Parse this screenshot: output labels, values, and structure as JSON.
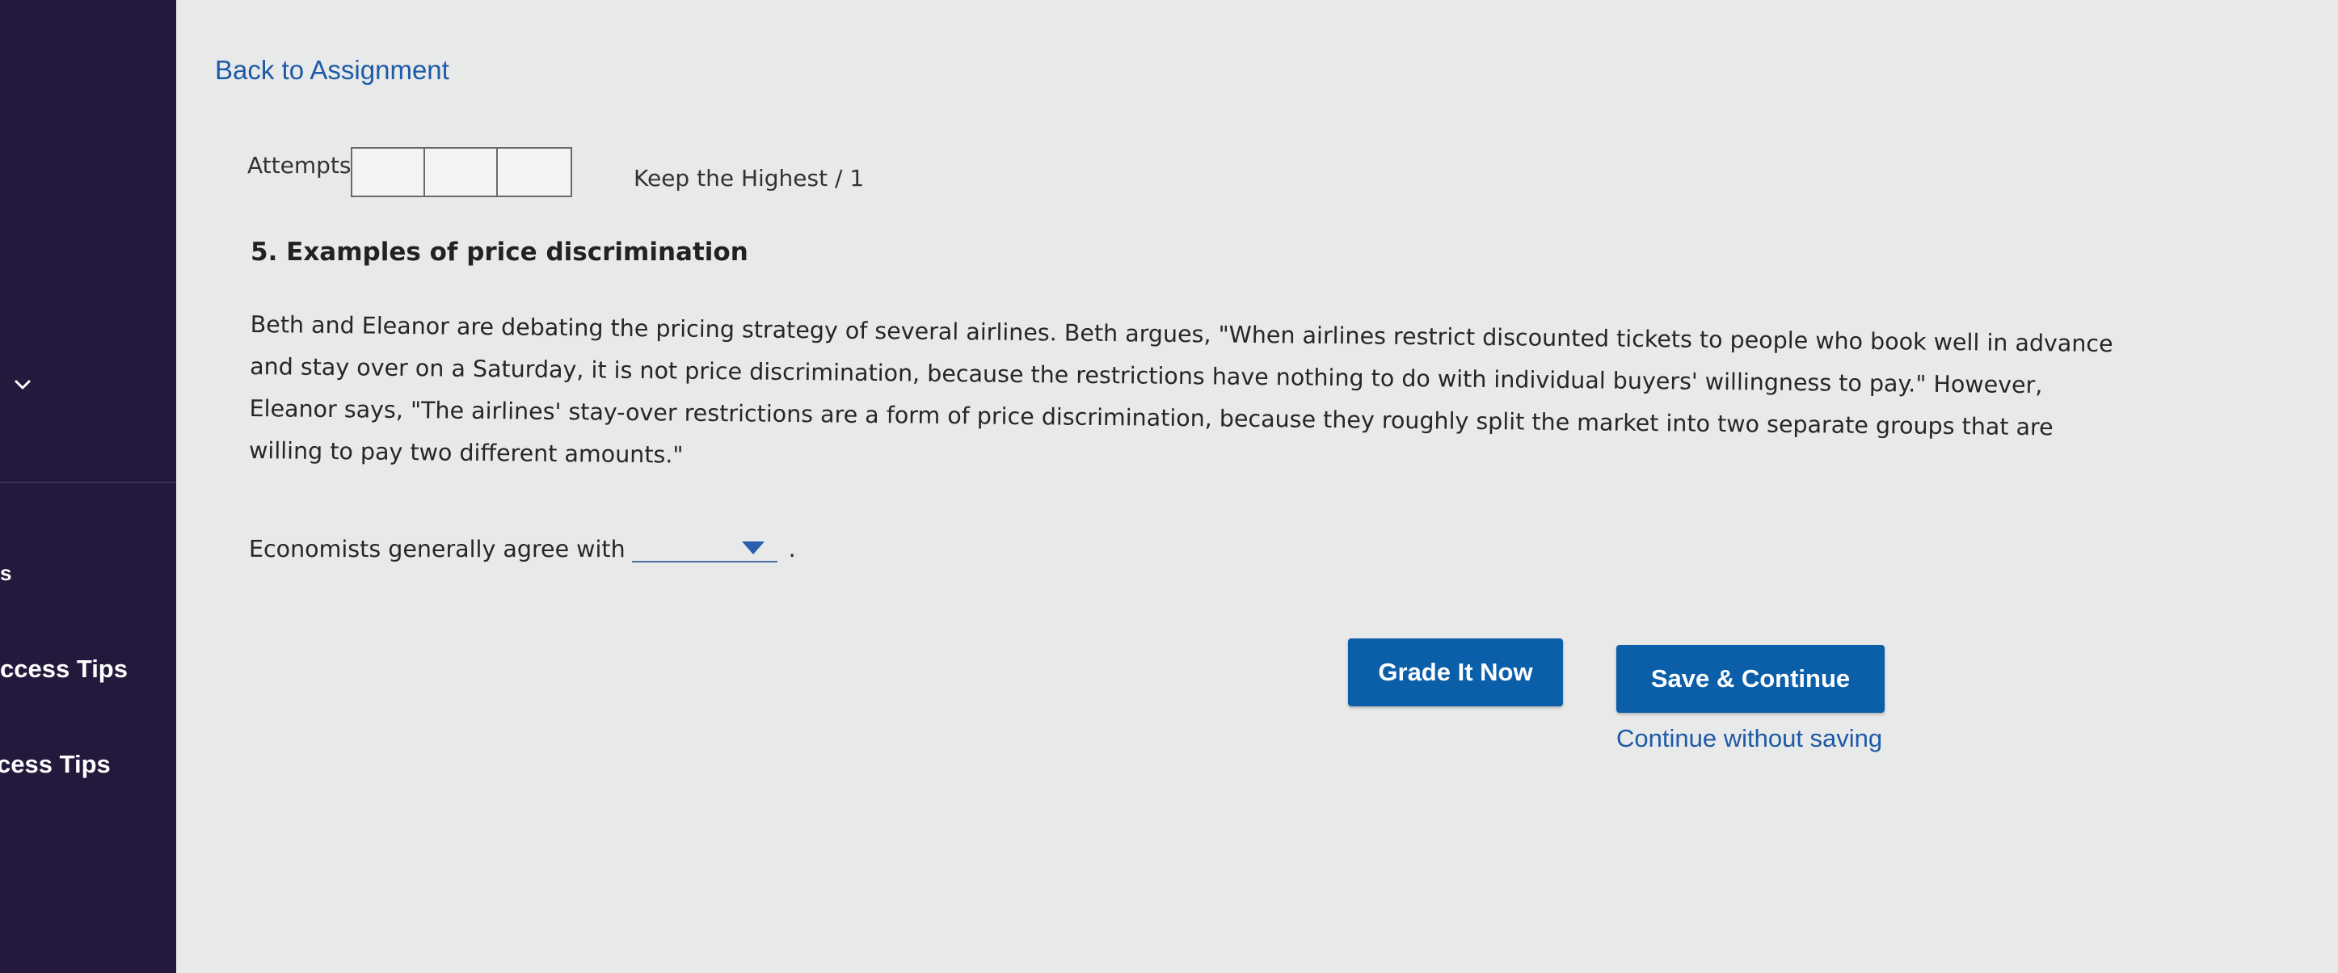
{
  "sidebar": {
    "partial_labels": [
      "s",
      "ccess Tips",
      "cess Tips"
    ]
  },
  "nav": {
    "back_link": "Back to Assignment"
  },
  "attempts": {
    "label": "Attempts",
    "policy": "Keep the Highest / 1"
  },
  "question": {
    "title": "5. Examples of price discrimination",
    "body": "Beth and Eleanor are debating the pricing strategy of several airlines. Beth argues, \"When airlines restrict discounted tickets to people who book well in advance and stay over on a Saturday, it is not price discrimination, because the restrictions have nothing to do with individual buyers' willingness to pay.\" However, Eleanor says, \"The airlines' stay-over restrictions are a form of price discrimination, because they roughly split the market into two separate groups that are willing to pay two different amounts.\"",
    "prompt": "Economists generally agree with",
    "selected_value": "",
    "period": "."
  },
  "actions": {
    "grade_label": "Grade It Now",
    "save_label": "Save & Continue",
    "continue_label": "Continue without saving"
  },
  "colors": {
    "sidebar_bg": "#23193c",
    "page_bg": "#e8e9e9",
    "button_bg": "#0b5ea8",
    "link": "#1d5aa8"
  }
}
